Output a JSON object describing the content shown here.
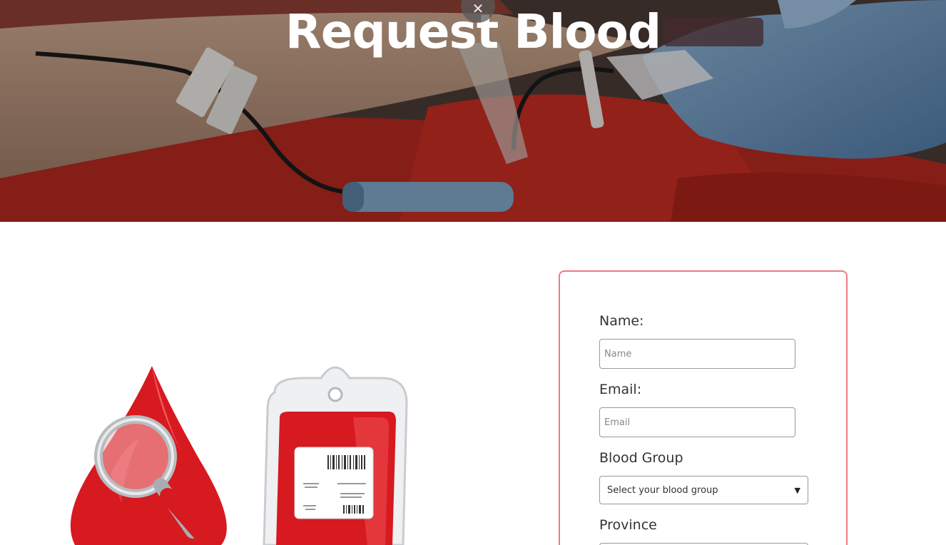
{
  "hero": {
    "title": "Request Blood",
    "close_glyph": "✕"
  },
  "icons": {
    "close": "close-icon",
    "blood_drop": "blood-drop-magnifier-icon",
    "blood_bag": "blood-bag-icon",
    "chevron": "chevron-down-icon"
  },
  "form": {
    "name_label": "Name:",
    "name_placeholder": "Name",
    "email_label": "Email:",
    "email_placeholder": "Email",
    "blood_group_label": "Blood Group",
    "blood_group_selected": "Select your blood group",
    "province_label": "Province"
  },
  "colors": {
    "card_border": "#ef7b82",
    "blood_red": "#d71920"
  }
}
